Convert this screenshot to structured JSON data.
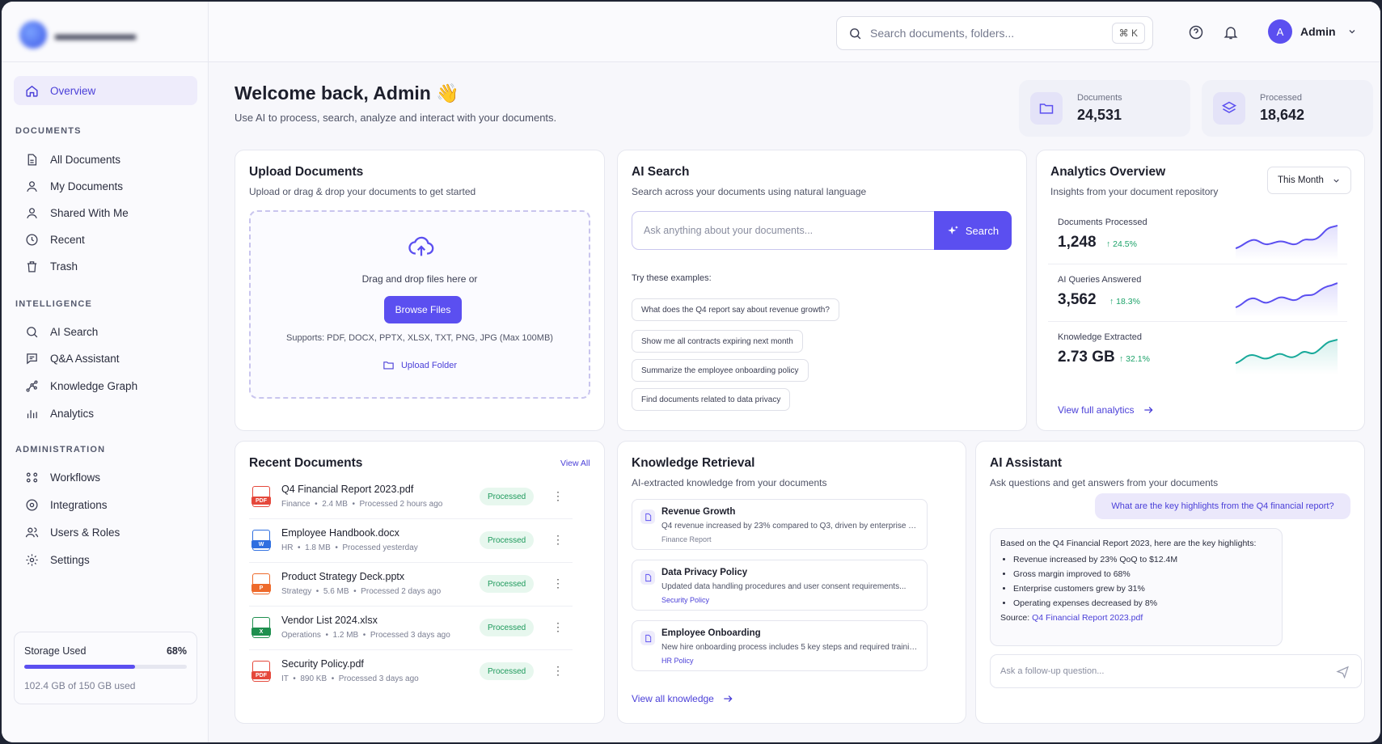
{
  "sidebar": {
    "overview": "Overview",
    "sections": {
      "documents": "DOCUMENTS",
      "intelligence": "INTELLIGENCE",
      "administration": "ADMINISTRATION"
    },
    "documents": [
      "All Documents",
      "My Documents",
      "Shared With Me",
      "Recent",
      "Trash"
    ],
    "intelligence": [
      "AI Search",
      "Q&A Assistant",
      "Knowledge Graph",
      "Analytics"
    ],
    "administration": [
      "Workflows",
      "Integrations",
      "Users & Roles",
      "Settings"
    ],
    "storage": {
      "label": "Storage Used",
      "percent_text": "68%",
      "fraction": 0.68,
      "sub": "102.4 GB of 150 GB used"
    }
  },
  "topbar": {
    "search_placeholder": "Search documents, folders...",
    "shortcut": "⌘ K",
    "user_initial": "A",
    "user_name": "Admin"
  },
  "welcome": {
    "title": "Welcome back, Admin 👋",
    "subtitle": "Use AI to process, search, analyze and interact with your documents."
  },
  "stats": [
    {
      "label": "Documents",
      "value": "24,531",
      "icon": "folder-icon"
    },
    {
      "label": "Processed",
      "value": "18,642",
      "icon": "layers-icon"
    }
  ],
  "upload": {
    "title": "Upload Documents",
    "subtitle": "Upload or drag & drop your documents to get started",
    "drag_text": "Drag and drop files here or",
    "browse": "Browse Files",
    "supports": "Supports: PDF, DOCX, PPTX, XLSX, TXT, PNG, JPG (Max 100MB)",
    "folder": "Upload Folder"
  },
  "ai_search": {
    "title": "AI Search",
    "subtitle": "Search across your documents using natural language",
    "placeholder": "Ask anything about your documents...",
    "button": "Search",
    "examples_label": "Try these examples:",
    "examples": [
      "What does the Q4 report say about revenue growth?",
      "Show me all contracts expiring next month",
      "Summarize the employee onboarding policy",
      "Find documents related to data privacy"
    ]
  },
  "analytics": {
    "title": "Analytics Overview",
    "subtitle": "Insights from your document repository",
    "period": "This Month",
    "metrics": [
      {
        "label": "Documents Processed",
        "value": "1,248",
        "change": "↑ 24.5%",
        "color": "#5b4ff0"
      },
      {
        "label": "AI Queries Answered",
        "value": "3,562",
        "change": "↑ 18.3%",
        "color": "#5b4ff0"
      },
      {
        "label": "Knowledge Extracted",
        "value": "2.73 GB",
        "change": "↑ 32.1%",
        "color": "#17a99a"
      }
    ],
    "link": "View full analytics"
  },
  "recent": {
    "title": "Recent Documents",
    "view_all": "View All",
    "docs": [
      {
        "name": "Q4 Financial Report 2023.pdf",
        "cat": "Finance",
        "size": "2.4 MB",
        "time": "Processed 2 hours ago",
        "status": "Processed",
        "type": "PDF",
        "color": "#e5483b"
      },
      {
        "name": "Employee Handbook.docx",
        "cat": "HR",
        "size": "1.8 MB",
        "time": "Processed yesterday",
        "status": "Processed",
        "type": "W",
        "color": "#2f6fe0"
      },
      {
        "name": "Product Strategy Deck.pptx",
        "cat": "Strategy",
        "size": "5.6 MB",
        "time": "Processed 2 days ago",
        "status": "Processed",
        "type": "P",
        "color": "#ee6a2b"
      },
      {
        "name": "Vendor List 2024.xlsx",
        "cat": "Operations",
        "size": "1.2 MB",
        "time": "Processed 3 days ago",
        "status": "Processed",
        "type": "X",
        "color": "#1e8f4e"
      },
      {
        "name": "Security Policy.pdf",
        "cat": "IT",
        "size": "890 KB",
        "time": "Processed 3 days ago",
        "status": "Processed",
        "type": "PDF",
        "color": "#e5483b"
      }
    ]
  },
  "knowledge": {
    "title": "Knowledge Retrieval",
    "subtitle": "AI-extracted knowledge from your documents",
    "items": [
      {
        "title": "Revenue Growth",
        "desc": "Q4 revenue increased by 23% compared to Q3, driven by enterprise sales...",
        "source": "Finance Report"
      },
      {
        "title": "Data Privacy Policy",
        "desc": "Updated data handling procedures and user consent requirements...",
        "source": "Security Policy"
      },
      {
        "title": "Employee Onboarding",
        "desc": "New hire onboarding process includes 5 key steps and required training...",
        "source": "HR Policy"
      }
    ],
    "link": "View all knowledge"
  },
  "assistant": {
    "title": "AI Assistant",
    "subtitle": "Ask questions and get answers from your documents",
    "question": "What are the key highlights from the Q4 financial report?",
    "answer_intro": "Based on the Q4 Financial Report 2023, here are the key highlights:",
    "bullets": [
      "Revenue increased by 23% QoQ to $12.4M",
      "Gross margin improved to 68%",
      "Enterprise customers grew by 31%",
      "Operating expenses decreased by 8%"
    ],
    "source_label": "Source:",
    "source": "Q4 Financial Report 2023.pdf",
    "placeholder": "Ask a follow-up question..."
  }
}
